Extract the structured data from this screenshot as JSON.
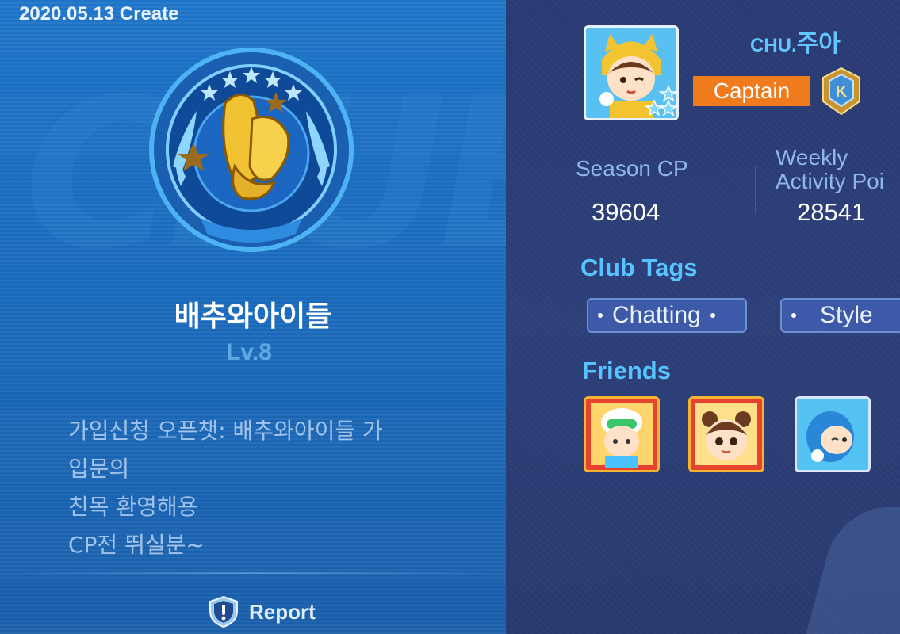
{
  "club": {
    "created": "2020.05.13 Create",
    "name": "배추와아이들",
    "level": "Lv.8",
    "description": [
      "가입신청 오픈챗: 배추와아이들 가",
      "입문의",
      "친목 환영해용",
      "CP전 뛰실분~"
    ],
    "background_word": "CLUB",
    "report_label": "Report"
  },
  "captain": {
    "name_prefix": "CHU.",
    "name": "주아",
    "role": "Captain"
  },
  "stats": {
    "season_cp_label": "Season CP",
    "season_cp_value": "39604",
    "weekly_label_line1": "Weekly",
    "weekly_label_line2": "Activity Poi",
    "weekly_value": "28541"
  },
  "tags": {
    "title": "Club Tags",
    "items": [
      "Chatting",
      "Style"
    ]
  },
  "friends": {
    "title": "Friends"
  },
  "colors": {
    "left_bg": "#1e74c8",
    "right_bg": "#2a3a72",
    "accent_blue": "#58c4ff",
    "captain_orange": "#ef7b1c"
  }
}
